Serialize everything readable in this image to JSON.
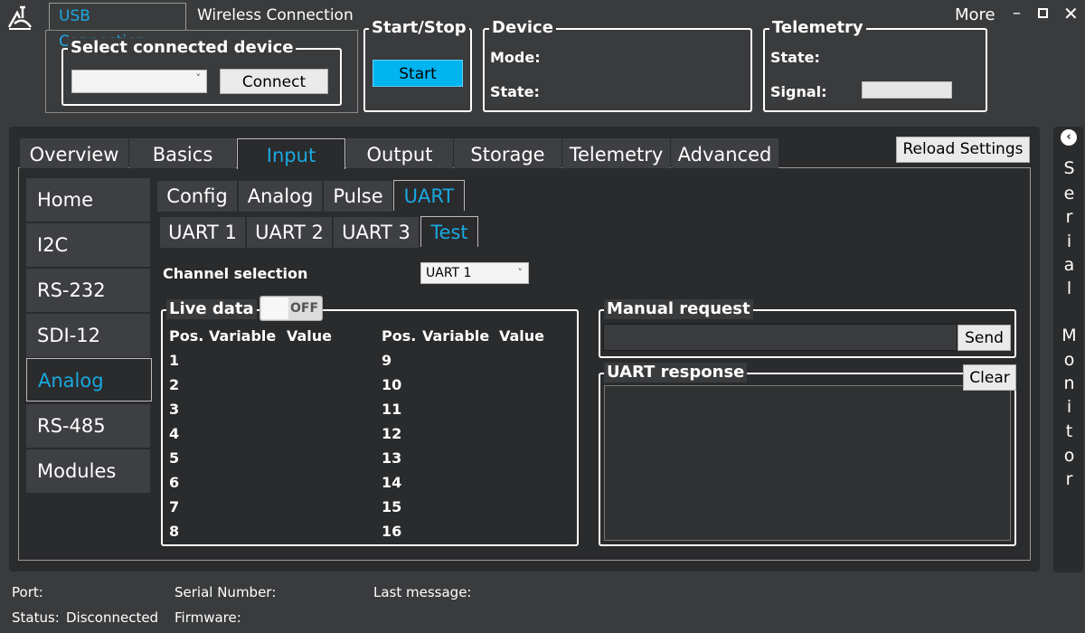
{
  "window": {
    "more_label": "More",
    "min_icon": "minimize-icon",
    "max_icon": "maximize-icon",
    "close_icon": "close-icon"
  },
  "connection": {
    "tabs": [
      "USB Connection",
      "Wireless Connection"
    ],
    "select_title": "Select connected device",
    "select_value": "",
    "connect_label": "Connect"
  },
  "startstop": {
    "title": "Start/Stop",
    "button": "Start"
  },
  "device": {
    "title": "Device",
    "mode_label": "Mode:",
    "state_label": "State:"
  },
  "telemetry": {
    "title": "Telemetry",
    "state_label": "State:",
    "signal_label": "Signal:"
  },
  "main_tabs": [
    "Overview",
    "Basics",
    "Input",
    "Output",
    "Storage",
    "Telemetry",
    "Advanced"
  ],
  "reload_label": "Reload Settings",
  "sidebar": [
    "Home",
    "I2C",
    "RS-232",
    "SDI-12",
    "Analog",
    "RS-485",
    "Modules"
  ],
  "sub_tabs": [
    "Config",
    "Analog",
    "Pulse",
    "UART"
  ],
  "uart_tabs": [
    "UART 1",
    "UART 2",
    "UART 3",
    "Test"
  ],
  "channel": {
    "label": "Channel selection",
    "value": "UART 1"
  },
  "live": {
    "title": "Live data",
    "toggle": "OFF",
    "headers": [
      "Pos.",
      "Variable",
      "Value"
    ],
    "left_pos": [
      "1",
      "2",
      "3",
      "4",
      "5",
      "6",
      "7",
      "8"
    ],
    "right_pos": [
      "9",
      "10",
      "11",
      "12",
      "13",
      "14",
      "15",
      "16"
    ]
  },
  "manual": {
    "title": "Manual request",
    "input_value": "",
    "send_label": "Send"
  },
  "response": {
    "title": "UART response",
    "clear_label": "Clear"
  },
  "serial_monitor": {
    "label": "Serial Monitor",
    "letters_top": [
      "S",
      "e",
      "r",
      "i",
      "a",
      "l"
    ],
    "letters_bottom": [
      "M",
      "o",
      "n",
      "i",
      "t",
      "o",
      "r"
    ]
  },
  "status": {
    "port_label": "Port:",
    "status_label": "Status:",
    "status_value": "Disconnected",
    "serial_label": "Serial Number:",
    "firmware_label": "Firmware:",
    "last_message_label": "Last message:"
  },
  "colors": {
    "accent": "#1aa8e0",
    "start_button": "#00b4f0"
  }
}
